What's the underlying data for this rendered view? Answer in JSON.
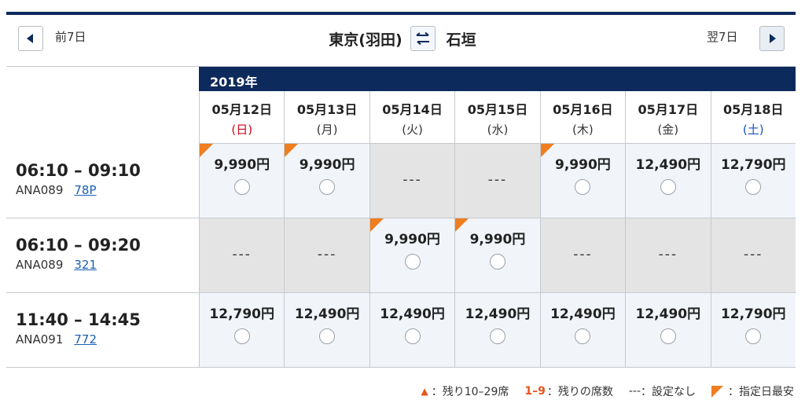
{
  "nav": {
    "prev_label": "前7日",
    "next_label": "翌7日"
  },
  "route": {
    "origin": "東京(羽田)",
    "destination": "石垣"
  },
  "year": "2019年",
  "dates": [
    {
      "md": "05月12日",
      "wd": "(日)",
      "type": "sun"
    },
    {
      "md": "05月13日",
      "wd": "(月)",
      "type": ""
    },
    {
      "md": "05月14日",
      "wd": "(火)",
      "type": ""
    },
    {
      "md": "05月15日",
      "wd": "(水)",
      "type": ""
    },
    {
      "md": "05月16日",
      "wd": "(木)",
      "type": ""
    },
    {
      "md": "05月17日",
      "wd": "(金)",
      "type": ""
    },
    {
      "md": "05月18日",
      "wd": "(土)",
      "type": "sat"
    }
  ],
  "flights": [
    {
      "time": "06:10 – 09:10",
      "flight_no": "ANA089",
      "equipment": "78P",
      "fares": [
        {
          "price": "9,990円",
          "cheapest": true
        },
        {
          "price": "9,990円",
          "cheapest": true
        },
        {
          "price": null,
          "dash": "---"
        },
        {
          "price": null,
          "dash": "---"
        },
        {
          "price": "9,990円",
          "cheapest": true
        },
        {
          "price": "12,490円",
          "cheapest": false
        },
        {
          "price": "12,790円",
          "cheapest": false
        }
      ]
    },
    {
      "time": "06:10 – 09:20",
      "flight_no": "ANA089",
      "equipment": "321",
      "fares": [
        {
          "price": null,
          "dash": "---"
        },
        {
          "price": null,
          "dash": "---"
        },
        {
          "price": "9,990円",
          "cheapest": true
        },
        {
          "price": "9,990円",
          "cheapest": true
        },
        {
          "price": null,
          "dash": "---"
        },
        {
          "price": null,
          "dash": "---"
        },
        {
          "price": null,
          "dash": "---"
        }
      ]
    },
    {
      "time": "11:40 – 14:45",
      "flight_no": "ANA091",
      "equipment": "772",
      "fares": [
        {
          "price": "12,790円",
          "cheapest": false
        },
        {
          "price": "12,490円",
          "cheapest": false
        },
        {
          "price": "12,490円",
          "cheapest": false
        },
        {
          "price": "12,490円",
          "cheapest": false
        },
        {
          "price": "12,490円",
          "cheapest": false
        },
        {
          "price": "12,490円",
          "cheapest": false
        },
        {
          "price": "12,790円",
          "cheapest": false
        }
      ]
    }
  ],
  "legend": {
    "triangle": "▲",
    "seats_text": "：残り10–29席",
    "num_range": "1–9",
    "num_text": "：残りの席数",
    "dash": "---",
    "dash_text": "：設定なし",
    "cheapest_text": "：指定日最安"
  },
  "colors": {
    "navy": "#0d2a5c",
    "cheapest_flag": "#f07d1e",
    "sunday": "#d0021b",
    "saturday": "#1a4fc4",
    "link": "#1a5fb4"
  }
}
